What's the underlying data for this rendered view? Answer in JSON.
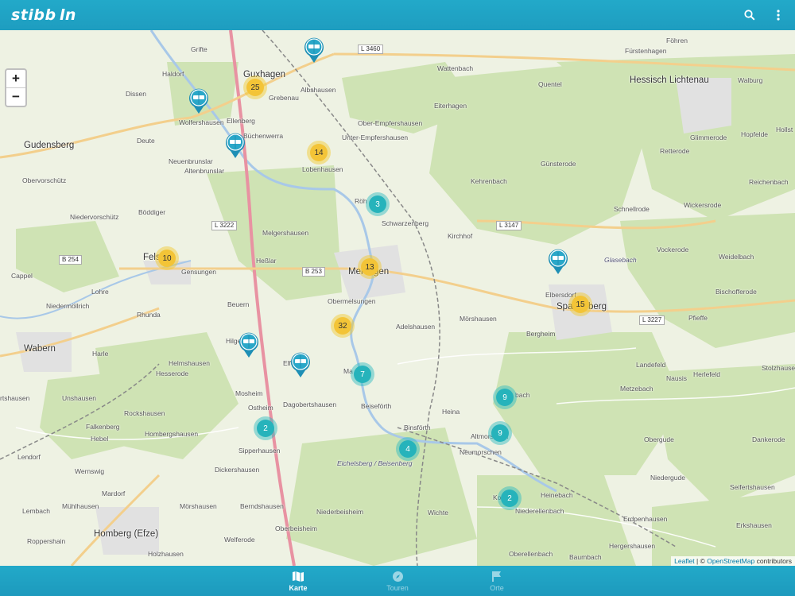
{
  "app": {
    "brand": "stibb ln"
  },
  "colors": {
    "bar": "#22a9c9",
    "cluster_yellow": "#f3c437",
    "cluster_teal": "#26b3bb"
  },
  "map": {
    "zoom_in": "+",
    "zoom_out": "−",
    "roads": [
      "L 3460",
      "L 3147",
      "L 3222",
      "B 254",
      "B 253",
      "L 3227"
    ],
    "areas": [
      "Glasebach",
      "Eichelsberg / Beisenberg"
    ],
    "places": {
      "guxhagen": "Guxhagen",
      "gudensberg": "Gudensberg",
      "wabern": "Wabern",
      "homberg": "Homberg (Efze)",
      "hessisch_lichtenau": "Hessisch Lichtenau",
      "melsungen_a": "Mel",
      "melsungen_b": "gen",
      "spangenberg_a": "Spa",
      "spangenberg_b": "berg",
      "grifte": "Grifte",
      "haldorf": "Haldorf",
      "dissen": "Dissen",
      "wolfershausen": "Wolfershausen",
      "ellenberg": "Ellenberg",
      "buchenwerra": "Büchenwerra",
      "deute": "Deute",
      "neuenbrunslar": "Neuenbrunslar",
      "altenbrunslar": "Altenbrunslar",
      "obervorschuetz": "Obervorschütz",
      "niedervorschuetz": "Niedervorschütz",
      "boddiger": "Böddiger",
      "felsberg": "Fels",
      "gensungen": "Gensungen",
      "cappel": "Cappel",
      "lohre": "Lohre",
      "niedermoellrich": "Niedermöllrich",
      "rhunda": "Rhunda",
      "harle": "Harle",
      "helmshausen": "Helmshausen",
      "hesserode": "Hesserode",
      "unshausen": "Unshausen",
      "rockshausen": "Rockshausen",
      "falkenberg": "Falkenberg",
      "hebel": "Hebel",
      "lendorf": "Lendorf",
      "wernswig": "Wernswig",
      "mardorf": "Mardorf",
      "lembach": "Lembach",
      "muehlhausen": "Mühlhausen",
      "roppershain": "Roppershain",
      "holzhausen": "Holzhausen",
      "albshausen": "Albshausen",
      "wattenbach": "Wattenbach",
      "grebenau": "Grebenau",
      "quentel": "Quentel",
      "eiterhagen": "Eiterhagen",
      "ober_empfershausen": "Ober-Empfershausen",
      "unter_empfershausen": "Unter-Empfershausen",
      "lobenhausen": "Lobenhausen",
      "fuerstenhagen": "Fürstenhagen",
      "foehren": "Föhren",
      "walburg": "Walburg",
      "guenterode": "Günsterode",
      "kehrenbach": "Kehrenbach",
      "roehrenfurth": "Röh",
      "schwarzenberg": "Schwarzenberg",
      "kirchhof": "Kirchhof",
      "melgershausen": "Melgershausen",
      "heiligenberg_a": "Heßlar",
      "obermelsungen": "Obermelsungen",
      "adelshausen": "Adelshausen",
      "moershausen": "Mörshausen",
      "beuern": "Beuern",
      "hilgershausen": "Hilge",
      "elfershausen": "Elfe",
      "malsfeld": "Ma",
      "mosheim": "Mosheim",
      "dagobertshausen": "Dagobertshausen",
      "ostheim": "Ostheim",
      "beiseforth": "Beiseförth",
      "binsforth": "Binsförth",
      "heina": "Heina",
      "altmorschen": "Altmorschen",
      "neumorschen": "Neumorschen",
      "sipperhausen": "Sipperhausen",
      "hombergshausen": "Hombergshausen",
      "dickershausen": "Dickershausen",
      "morshausen2": "Mörshausen",
      "berndshausen": "Berndshausen",
      "niederbeisheim": "Niederbeisheim",
      "oberbeisheim": "Oberbeisheim",
      "wichte": "Wichte",
      "welferode": "Welferode",
      "heinebach": "Heinebach",
      "niederellenbach": "Niederellenbach",
      "oberellenbach": "Oberellenbach",
      "baumbach": "Baumbach",
      "konnefeld": "Ko",
      "bergheim": "Bergheim",
      "elbersdorf": "Elbersdorf",
      "schnellrode": "Schnellrode",
      "wickersrode": "Wickersrode",
      "vockerode": "Vockerode",
      "weidelbach": "Weidelbach",
      "bischofferode": "Bischofferode",
      "pfieffe": "Pfieffe",
      "landefeld": "Landefeld",
      "nausis": "Nausis",
      "metzebach": "Metzebach",
      "herlefeld": "Herlefeld",
      "stolzhausen": "Stolzhausen",
      "obergude": "Obergude",
      "niedergude": "Niedergude",
      "erdpenhausen": "Erdpenhausen",
      "hergershausen": "Hergershausen",
      "dankerode": "Dankerode",
      "seifertshausen": "Seifertshausen",
      "erkshausen": "Erkshausen",
      "glimmerode": "Glimmerode",
      "hopfelde": "Hopfelde",
      "retterode": "Retterode",
      "reichenbach": "Reichenbach",
      "hollstein": "Hollst",
      "rthausen": "rtshausen",
      "bach_a": "bach"
    },
    "clusters": [
      {
        "id": "c25",
        "count": "25",
        "kind": "y"
      },
      {
        "id": "c14",
        "count": "14",
        "kind": "y"
      },
      {
        "id": "c10",
        "count": "10",
        "kind": "y"
      },
      {
        "id": "c13",
        "count": "13",
        "kind": "y"
      },
      {
        "id": "c32",
        "count": "32",
        "kind": "y"
      },
      {
        "id": "c15",
        "count": "15",
        "kind": "y"
      },
      {
        "id": "c3",
        "count": "3",
        "kind": "t"
      },
      {
        "id": "c7",
        "count": "7",
        "kind": "t"
      },
      {
        "id": "c9a",
        "count": "9",
        "kind": "t"
      },
      {
        "id": "c9b",
        "count": "9",
        "kind": "t"
      },
      {
        "id": "c4",
        "count": "4",
        "kind": "t"
      },
      {
        "id": "c2a",
        "count": "2",
        "kind": "t"
      },
      {
        "id": "c2b",
        "count": "2",
        "kind": "t"
      }
    ],
    "attribution": {
      "leaflet": "Leaflet",
      "sep": " | © ",
      "osm": "OpenStreetMap",
      "rest": " contributors"
    }
  },
  "nav": {
    "tab1": "Karte",
    "tab2": "Touren",
    "tab3": "Orte"
  }
}
